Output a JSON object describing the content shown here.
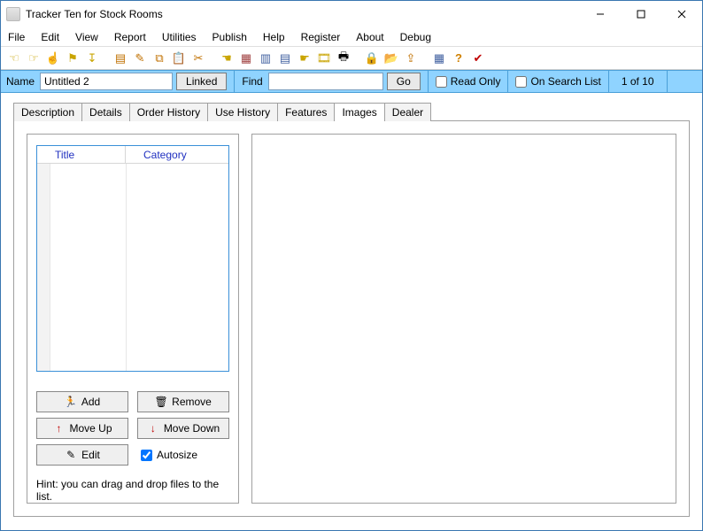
{
  "window": {
    "title": "Tracker Ten for Stock Rooms"
  },
  "menu": {
    "items": [
      "File",
      "Edit",
      "View",
      "Report",
      "Utilities",
      "Publish",
      "Help",
      "Register",
      "About",
      "Debug"
    ]
  },
  "namebar": {
    "name_label": "Name",
    "name_value": "Untitled 2",
    "linked_btn": "Linked",
    "find_label": "Find",
    "find_value": "",
    "go_btn": "Go",
    "readonly_label": "Read Only",
    "readonly_checked": false,
    "onsearch_label": "On Search List",
    "onsearch_checked": false,
    "counter": "1 of 10"
  },
  "tabs": {
    "items": [
      "Description",
      "Details",
      "Order History",
      "Use History",
      "Features",
      "Images",
      "Dealer"
    ],
    "active": 5
  },
  "list": {
    "col1": "Title",
    "col2": "Category"
  },
  "buttons": {
    "add": "Add",
    "remove": "Remove",
    "moveup": "Move Up",
    "movedown": "Move Down",
    "edit": "Edit",
    "autosize": "Autosize",
    "autosize_checked": true
  },
  "hint": "Hint: you can drag and drop files to the list."
}
